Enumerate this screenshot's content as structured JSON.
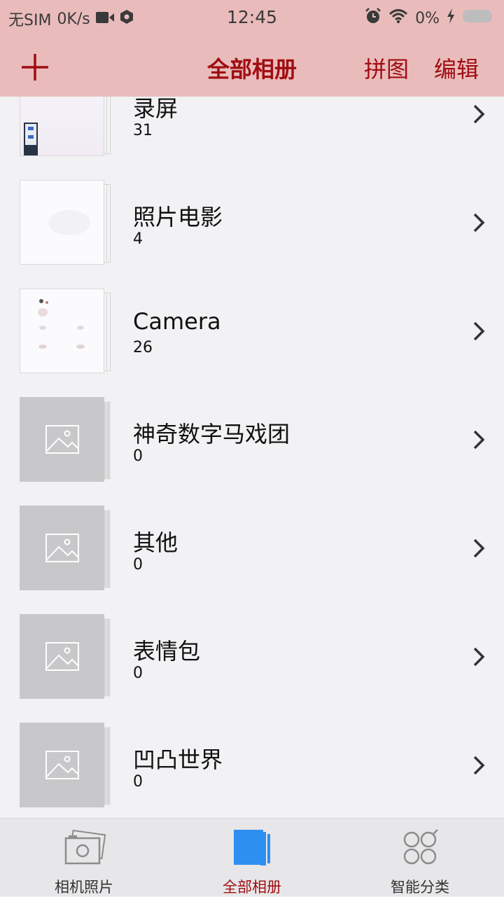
{
  "status_bar": {
    "carrier": "无SIM",
    "speed": "0K/s",
    "time": "12:45",
    "battery": "0%",
    "icons": [
      "video-icon",
      "hexagon-icon",
      "alarm-icon",
      "wifi-icon",
      "charging-icon",
      "battery-icon"
    ]
  },
  "header": {
    "title": "全部相册",
    "add_icon": "plus-icon",
    "collage_label": "拼图",
    "edit_label": "编辑"
  },
  "albums": [
    {
      "name": "录屏",
      "count": "31",
      "thumb": "screenshot"
    },
    {
      "name": "照片电影",
      "count": "4",
      "thumb": "light"
    },
    {
      "name": "Camera",
      "count": "26",
      "thumb": "light"
    },
    {
      "name": "神奇数字马戏团",
      "count": "0",
      "thumb": "placeholder-image-icon"
    },
    {
      "name": "其他",
      "count": "0",
      "thumb": "placeholder-image-icon"
    },
    {
      "name": "表情包",
      "count": "0",
      "thumb": "placeholder-image-icon"
    },
    {
      "name": "凹凸世界",
      "count": "0",
      "thumb": "placeholder-image-icon"
    }
  ],
  "tabs": [
    {
      "label": "相机照片",
      "icon": "camera-photos-icon",
      "active": false
    },
    {
      "label": "全部相册",
      "icon": "all-albums-icon",
      "active": true
    },
    {
      "label": "智能分类",
      "icon": "smart-category-icon",
      "active": false
    }
  ],
  "colors": {
    "header_bg": "#e9bcbb",
    "accent": "#a00d12",
    "tab_active_icon": "#2d8ff0"
  }
}
